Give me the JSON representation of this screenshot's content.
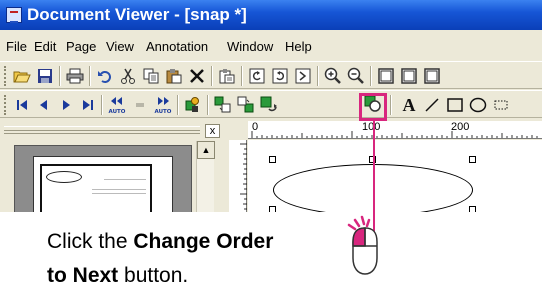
{
  "window": {
    "title": "Document Viewer - [snap *]"
  },
  "menu": {
    "items": [
      "File",
      "Edit",
      "Page",
      "View",
      "Annotation",
      "Window",
      "Help"
    ]
  },
  "toolbar1": {
    "icons": [
      "open-icon",
      "save-icon",
      "print-icon",
      "undo-icon",
      "cut-icon",
      "copy-icon",
      "paste-icon",
      "delete-icon",
      "paste-special-icon",
      "rotate-left-icon",
      "rotate-right-icon",
      "rotate-page-icon",
      "zoom-in-icon",
      "zoom-out-icon",
      "page-view-icon",
      "two-page-icon",
      "fit-page-icon"
    ]
  },
  "toolbar2": {
    "icons": [
      "first-page-icon",
      "previous-page-icon",
      "next-page-icon",
      "last-page-icon",
      "auto-backward-icon",
      "stop-icon",
      "auto-forward-icon",
      "annotation-tool-icon",
      "bring-to-front-icon",
      "send-to-back-icon",
      "change-order-to-previous-icon",
      "change-order-to-next-icon",
      "text-icon",
      "line-icon",
      "rectangle-icon",
      "ellipse-icon",
      "dashed-rectangle-icon"
    ],
    "auto_label": "AUTO",
    "highlighted": "change-order-to-next-icon",
    "text_tool_label": "A"
  },
  "ruler": {
    "labels": [
      "0",
      "100",
      "200"
    ]
  },
  "panel": {
    "close_label": "x",
    "scroll_up": "▲"
  },
  "instruction": {
    "part1": "Click the ",
    "bold1": "Change Order",
    "bold2": "to Next",
    "part2": " button."
  },
  "colors": {
    "highlight": "#d8267e",
    "title_bar": "#1656d6",
    "mouse_button": "#d8267e"
  }
}
